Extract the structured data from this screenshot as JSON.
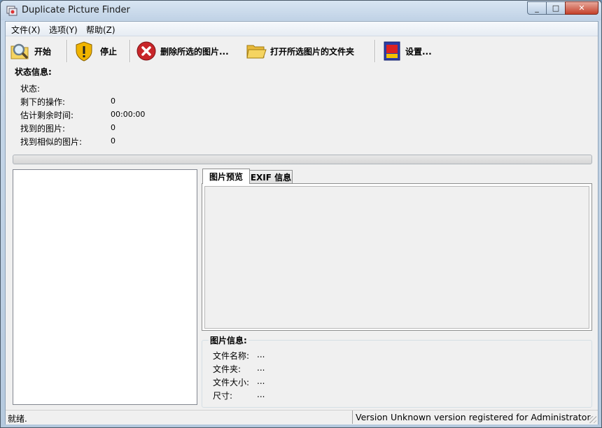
{
  "window": {
    "title": "Duplicate Picture Finder"
  },
  "caption": {
    "minimize": "_",
    "maximize": "□",
    "close": "✕"
  },
  "menu": [
    "文件(X)",
    "选项(Y)",
    "帮助(Z)"
  ],
  "toolbar": {
    "start": "开始",
    "stop": "停止",
    "delete_selected": "删除所选的图片...",
    "open_folder": "打开所选图片的文件夹",
    "settings": "设置..."
  },
  "status_info": {
    "title": "状态信息:",
    "rows": [
      {
        "label": "状态:",
        "value": ""
      },
      {
        "label": "剩下的操作:",
        "value": "0"
      },
      {
        "label": "估计剩余时间:",
        "value": "00:00:00"
      },
      {
        "label": "找到的图片:",
        "value": "0"
      },
      {
        "label": "找到相似的图片:",
        "value": "0"
      }
    ]
  },
  "progress": {
    "value": 0
  },
  "tabs": [
    {
      "label": "图片预览",
      "active": true
    },
    {
      "label": "EXIF 信息",
      "active": false
    }
  ],
  "picture_info": {
    "title": "图片信息:",
    "rows": [
      {
        "label": "文件名称:",
        "value": "..."
      },
      {
        "label": "文件夹:",
        "value": "..."
      },
      {
        "label": "文件大小:",
        "value": "..."
      },
      {
        "label": "尺寸:",
        "value": "..."
      }
    ]
  },
  "statusbar": {
    "left": "就绪.",
    "right": "Version Unknown version registered for Administrator"
  },
  "colors": {
    "titlebar": "#c9d9ea",
    "delete_icon_red": "#c8262a",
    "stop_icon_yellow": "#f0b400",
    "folder_yellow": "#f5d461"
  }
}
